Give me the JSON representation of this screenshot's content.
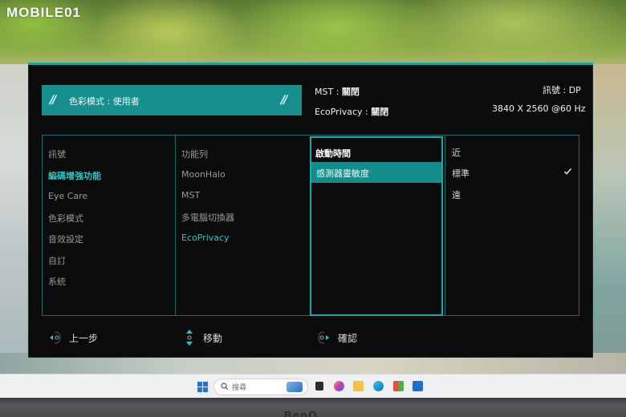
{
  "watermark": {
    "brand": "MOBILE01"
  },
  "osd": {
    "mode_bar": {
      "label": "色彩模式",
      "value": "使用者"
    },
    "status": {
      "mst_label": "MST",
      "mst_value": "關閉",
      "ecoprivacy_label": "EcoPrivacy",
      "ecoprivacy_value": "關閉",
      "signal_label": "訊號",
      "signal_value": "DP",
      "resolution": "3840 X 2560 @60 Hz"
    },
    "menu": {
      "column1": [
        "訊號",
        "編碼增強功能",
        "Eye Care",
        "色彩模式",
        "音效設定",
        "自訂",
        "系統"
      ],
      "column1_active_index": 1,
      "column2": [
        "功能列",
        "MoonHalo",
        "MST",
        "多電腦切換器",
        "EcoPrivacy"
      ],
      "column2_active_index": 4,
      "column3": [
        "啟動時間",
        "感測器靈敏度"
      ],
      "column3_selected_index": 1,
      "column4": [
        "近",
        "標準",
        "遠"
      ],
      "column4_checked_index": 1
    },
    "footer": {
      "back": "上一步",
      "move": "移動",
      "confirm": "確認"
    },
    "colors": {
      "accent": "#1aa4a3",
      "highlight": "#148c8c",
      "active_text": "#2fc4c4",
      "background": "#0b0b0b"
    }
  },
  "taskbar": {
    "search_placeholder": "搜尋",
    "icons": [
      "windows-start-icon",
      "search-icon",
      "widgets-icon",
      "task-view-icon",
      "copilot-icon",
      "file-explorer-icon",
      "edge-icon",
      "store-icon",
      "outlook-icon"
    ]
  },
  "bezel": {
    "logo": "BenQ"
  }
}
